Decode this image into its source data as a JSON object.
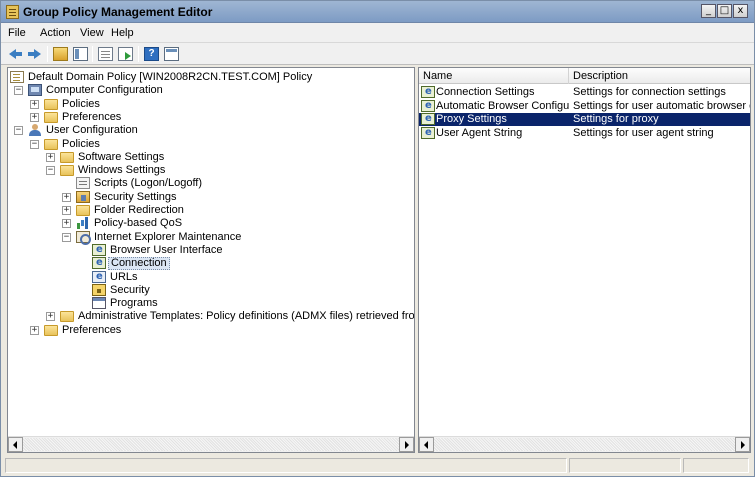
{
  "window": {
    "title": "Group Policy Management Editor",
    "controls": [
      "_",
      "□",
      "x"
    ]
  },
  "menu": [
    "File",
    "Action",
    "View",
    "Help"
  ],
  "toolbar": {
    "help_label": "?"
  },
  "tree": [
    {
      "label": "Default Domain Policy [WIN2008R2CN.TEST.COM] Policy",
      "icon": "policy-doc-icon",
      "expander": ""
    },
    {
      "label": "Computer Configuration",
      "icon": "computer-icon",
      "expander": "−"
    },
    {
      "label": "Policies",
      "icon": "folder-icon",
      "expander": "+"
    },
    {
      "label": "Preferences",
      "icon": "folder-icon",
      "expander": "+"
    },
    {
      "label": "User Configuration",
      "icon": "user-icon",
      "expander": "−"
    },
    {
      "label": "Policies",
      "icon": "folder-icon",
      "expander": "−"
    },
    {
      "label": "Software Settings",
      "icon": "folder-icon",
      "expander": "+"
    },
    {
      "label": "Windows Settings",
      "icon": "folder-icon",
      "expander": "−"
    },
    {
      "label": "Scripts (Logon/Logoff)",
      "icon": "script-icon",
      "expander": ""
    },
    {
      "label": "Security Settings",
      "icon": "security-settings-icon",
      "expander": "+"
    },
    {
      "label": "Folder Redirection",
      "icon": "folder-icon",
      "expander": "+"
    },
    {
      "label": "Policy-based QoS",
      "icon": "qos-chart-icon",
      "expander": "+"
    },
    {
      "label": "Internet Explorer Maintenance",
      "icon": "ie-maintenance-icon",
      "expander": "−"
    },
    {
      "label": "Browser User Interface",
      "icon": "ie-setting-icon",
      "expander": ""
    },
    {
      "label": "Connection",
      "icon": "ie-setting-icon",
      "expander": ""
    },
    {
      "label": "URLs",
      "icon": "ie-urls-icon",
      "expander": ""
    },
    {
      "label": "Security",
      "icon": "lock-icon",
      "expander": ""
    },
    {
      "label": "Programs",
      "icon": "programs-icon",
      "expander": ""
    },
    {
      "label": "Administrative Templates: Policy definitions (ADMX files) retrieved from the local mac",
      "icon": "folder-icon",
      "expander": "+"
    },
    {
      "label": "Preferences",
      "icon": "folder-icon",
      "expander": "+"
    }
  ],
  "list": {
    "columns": [
      "Name",
      "Description"
    ],
    "rows": [
      {
        "name": "Connection Settings",
        "description": "Settings for connection settings"
      },
      {
        "name": "Automatic Browser Configurat...",
        "description": "Settings for user automatic browser configuration"
      },
      {
        "name": "Proxy Settings",
        "description": "Settings for proxy"
      },
      {
        "name": "User Agent String",
        "description": "Settings for user agent string"
      }
    ],
    "selected_index": 2
  },
  "colors": {
    "selection": "#0a246a",
    "titlebar": "#8aa6cc"
  }
}
